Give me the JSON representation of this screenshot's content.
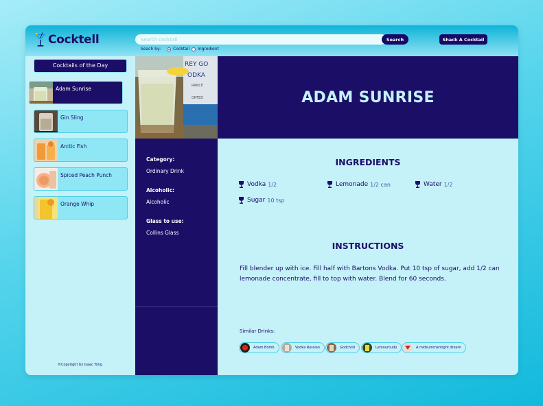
{
  "app": {
    "brand": "Cocktell"
  },
  "header": {
    "search_placeholder": "Search cocktail",
    "search_button": "Search",
    "shack_button": "Shack A Cocktail",
    "search_by_label": "Seach by:",
    "search_by_options": [
      {
        "label": "Cocktail",
        "selected": true
      },
      {
        "label": "Ingredient",
        "selected": false
      }
    ]
  },
  "sidebar": {
    "heading": "Cocktails of the Day",
    "drinks": [
      {
        "name": "Adam Sunrise",
        "active": true
      },
      {
        "name": "Gin Sling",
        "active": false
      },
      {
        "name": "Arctic Fish",
        "active": false
      },
      {
        "name": "Spiced Peach Punch",
        "active": false
      },
      {
        "name": "Orange Whip",
        "active": false
      }
    ],
    "copyright": "©Copyright by Isaac Tong"
  },
  "drink": {
    "title": "ADAM SUNRISE",
    "category_label": "Category:",
    "category": "Ordinary Drink",
    "alcoholic_label": "Alcoholic:",
    "alcoholic": "Alcoholic",
    "glass_label": "Glass to use:",
    "glass": "Collins Glass",
    "photo_text": "REY GO\nODKA\nRANCE\nORTED",
    "ingredients_heading": "INGREDIENTS",
    "ingredients": [
      {
        "name": "Vodka",
        "measure": "1/2"
      },
      {
        "name": "Lemonade",
        "measure": "1/2 can"
      },
      {
        "name": "Water",
        "measure": "1/2"
      },
      {
        "name": "Sugar",
        "measure": "10 tsp"
      }
    ],
    "instructions_heading": "INSTRUCTIONS",
    "instructions": "Fill blender up with ice. Fill half with Bartons Vodka. Put 10 tsp of sugar, add 1/2 can lemonade concentrate, fill to top with water. Blend for 60 seconds.",
    "similar_label": "Similar Drinks:",
    "similar": [
      "Adam Bomb",
      "Vodka Russian",
      "Godchild",
      "Lemouroudji",
      "A midsummernight dream"
    ]
  },
  "colors": {
    "navy": "#1b0e67",
    "panel": "#c5f1f9",
    "card": "#8fe7f5",
    "accent": "#0eb3d8"
  }
}
